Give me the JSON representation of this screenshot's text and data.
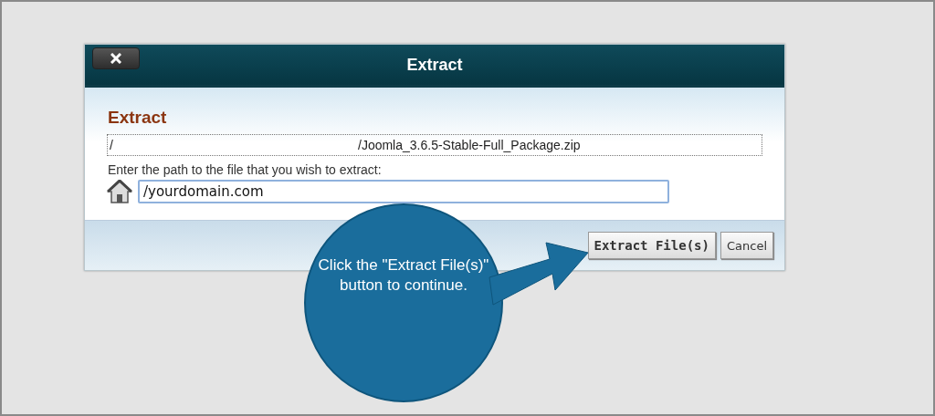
{
  "dialog": {
    "title": "Extract",
    "heading": "Extract",
    "path": {
      "directory": "/",
      "file": "/Joomla_3.6.5-Stable-Full_Package.zip"
    },
    "prompt": "Enter the path to the file that you wish to extract:",
    "input": {
      "value": "/yourdomain.com"
    },
    "buttons": [
      {
        "label": "Extract File(s)",
        "kind": "primary"
      },
      {
        "label": "Cancel",
        "kind": "secondary"
      }
    ]
  },
  "callout": {
    "text": "Click the \"Extract File(s)\" button to continue."
  }
}
